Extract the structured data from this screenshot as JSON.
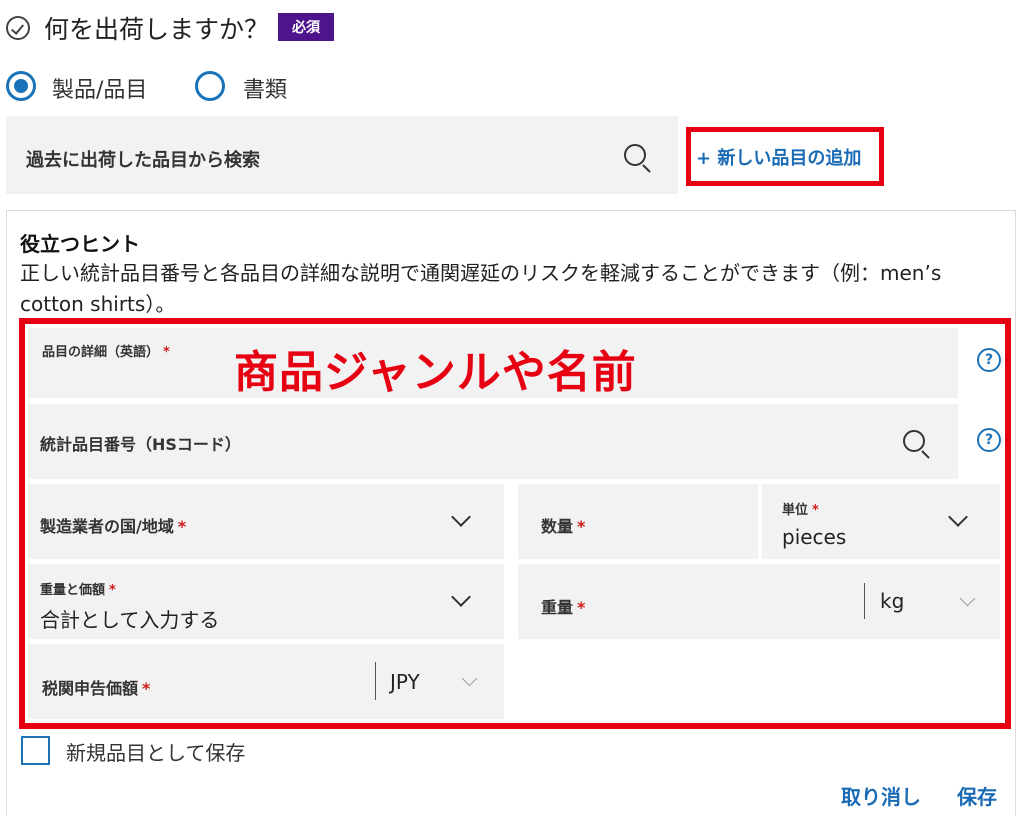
{
  "question": {
    "title": "何を出荷しますか？",
    "badge": "必須"
  },
  "shipment_type": {
    "options": [
      {
        "label": "製品/品目",
        "selected": true
      },
      {
        "label": "書類",
        "selected": false
      }
    ]
  },
  "search": {
    "placeholder": "過去に出荷した品目から検索",
    "icon": "search-icon"
  },
  "add_item": {
    "label": "+ 新しい品目の追加"
  },
  "hint": {
    "title": "役立つヒント",
    "body": "正しい統計品目番号と各品目の詳細な説明で通関遅延のリスクを軽減することができます（例：men’s cotton shirts）。"
  },
  "annotation": {
    "text": "商品ジャンルや名前",
    "color": "#e60012"
  },
  "fields": {
    "description": {
      "label": "品目の詳細（英語）",
      "required": "*"
    },
    "hs_code": {
      "label": "統計品目番号（HSコード）"
    },
    "country": {
      "label": "製造業者の国/地域",
      "required": "*"
    },
    "quantity": {
      "label": "数量",
      "required": "*"
    },
    "unit": {
      "label": "単位",
      "required": "*",
      "value": "pieces"
    },
    "weight_value": {
      "label": "重量と価額",
      "required": "*",
      "value": "合計として入力する"
    },
    "weight": {
      "label": "重量",
      "required": "*",
      "unit": "kg"
    },
    "customs_value": {
      "label": "税関申告価額",
      "required": "*",
      "currency": "JPY"
    }
  },
  "save_new": {
    "label": "新規品目として保存",
    "checked": false
  },
  "actions": {
    "cancel": "取り消し",
    "save": "保存"
  },
  "colors": {
    "accent": "#1a73b8",
    "brand_purple": "#4d148c",
    "required_star": "#d21b1b",
    "field_bg": "#f2f2f2"
  }
}
